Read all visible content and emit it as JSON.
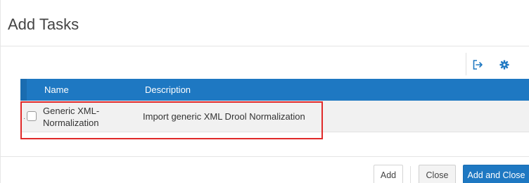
{
  "dialog": {
    "title": "Add Tasks"
  },
  "toolbar": {
    "export_icon": "export-icon",
    "settings_icon": "gear-icon"
  },
  "table": {
    "columns": [
      "Name",
      "Description"
    ],
    "rows": [
      {
        "selected": false,
        "name": "Generic XML-\nNormalization",
        "description": "Import generic XML Drool Normalization"
      }
    ]
  },
  "footer": {
    "add_label": "Add",
    "close_label": "Close",
    "add_and_close_label": "Add and Close"
  },
  "colors": {
    "accent": "#1e78c2",
    "highlight": "#e02a2a"
  }
}
